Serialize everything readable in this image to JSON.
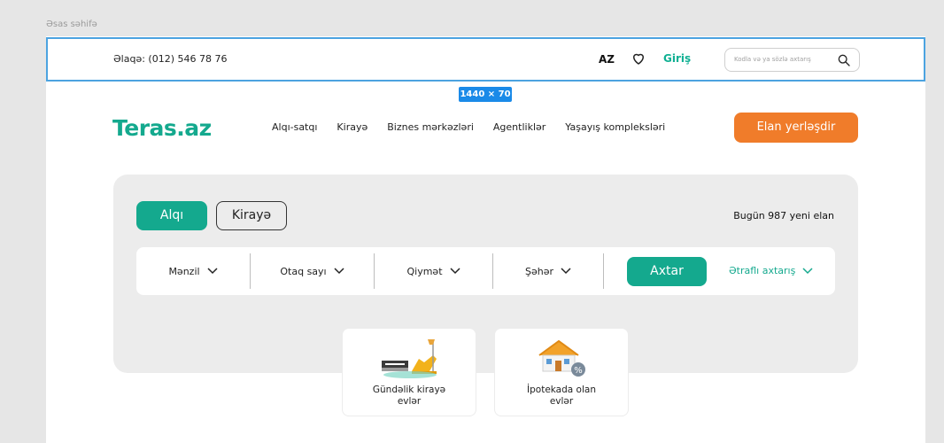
{
  "page_label": "Əsas səhifə",
  "topbar": {
    "contact": "Əlaqə: (012) 546 78 76",
    "lang": "AZ",
    "favorites_icon": "heart-icon",
    "login": "Giriş",
    "search_placeholder": "Kodla və ya sözlə axtarış",
    "search_icon": "search-icon"
  },
  "dimension_badge": "1440 × 70",
  "header": {
    "logo": "Teras.az",
    "nav": [
      "Alqı-satqı",
      "Kirayə",
      "Biznes mərkəzləri",
      "Agentliklər",
      "Yaşayış kompleksləri"
    ],
    "post_button": "Elan yerləşdir"
  },
  "search_panel": {
    "tabs": [
      "Alqı",
      "Kirayə"
    ],
    "active_tab": "Alqı",
    "today_count": "Bugün 987 yeni elan",
    "filters": [
      "Mənzil",
      "Otaq sayı",
      "Qiymət",
      "Şəhər"
    ],
    "search_button": "Axtar",
    "advanced": "Ətraflı axtarış"
  },
  "categories": [
    {
      "label_line1": "Gündəlik kirayə",
      "label_line2": "evlər",
      "icon": "furniture-icon"
    },
    {
      "label_line1": "İpotekada olan",
      "label_line2": "evlər",
      "icon": "house-percent-icon"
    }
  ],
  "colors": {
    "accent": "#14a98e",
    "orange": "#f07c2a",
    "selection": "#4ca3e0",
    "badge": "#1a8ae8"
  }
}
